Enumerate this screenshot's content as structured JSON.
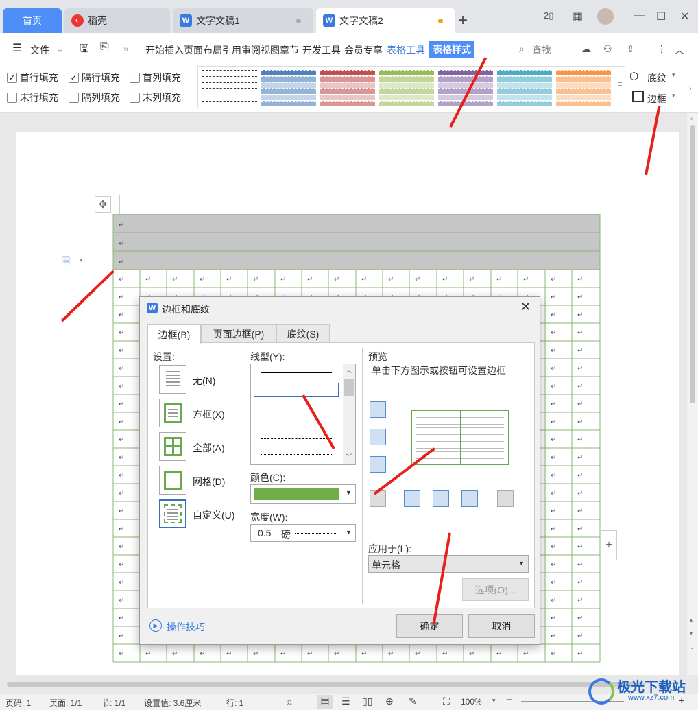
{
  "tabs": {
    "home": "首页",
    "daoke": "稻壳",
    "doc1": "文字文稿1",
    "doc2": "文字文稿2"
  },
  "toolbar": {
    "file": "文件",
    "menu_items": [
      "开始",
      "插入",
      "页面布局",
      "引用",
      "审阅",
      "视图",
      "章节",
      "开发工具",
      "会员专享"
    ],
    "table_tools": "表格工具",
    "table_style": "表格样式",
    "search": "查找"
  },
  "ribbon": {
    "first_row_fill": "首行填充",
    "alt_row_fill": "隔行填充",
    "first_col_fill": "首列填充",
    "last_row_fill": "末行填充",
    "alt_col_fill": "隔列填充",
    "last_col_fill": "末列填充",
    "shading": "底纹",
    "border": "边框",
    "style_colors": [
      "#ffffff",
      "#4f81bd",
      "#c0504d",
      "#9bbb59",
      "#8064a2",
      "#4bacc6",
      "#f79646"
    ]
  },
  "dialog": {
    "title": "边框和底纹",
    "tabs": [
      "边框(B)",
      "页面边框(P)",
      "底纹(S)"
    ],
    "settings_label": "设置:",
    "settings": [
      "无(N)",
      "方框(X)",
      "全部(A)",
      "网格(D)",
      "自定义(U)"
    ],
    "line_type_label": "线型(Y):",
    "color_label": "颜色(C):",
    "color_value": "#70ad47",
    "width_label": "宽度(W):",
    "width_value": "0.5",
    "width_unit": "磅",
    "preview_label": "预览",
    "preview_hint": "单击下方图示或按钮可设置边框",
    "apply_label": "应用于(L):",
    "apply_value": "单元格",
    "options": "选项(O)...",
    "tips": "操作技巧",
    "ok": "确定",
    "cancel": "取消"
  },
  "status": {
    "page_num": "页码: 1",
    "pages": "页面: 1/1",
    "section": "节: 1/1",
    "setting": "设置值: 3.6厘米",
    "row": "行: 1",
    "zoom": "100%"
  },
  "watermark": "极光下载站",
  "watermark_url": "www.xz7.com",
  "para_mark": "↵"
}
